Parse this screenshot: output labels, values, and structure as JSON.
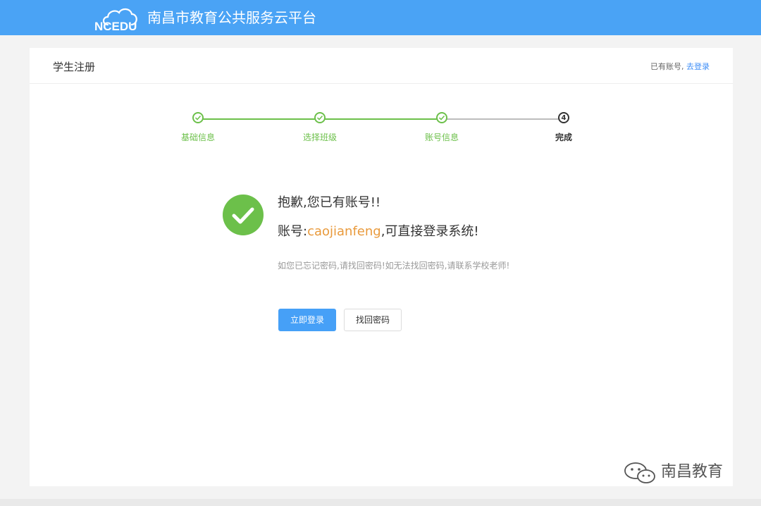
{
  "header": {
    "logo_text": "NCEDU",
    "site_title": "南昌市教育公共服务云平台",
    "brand_color": "#4aa3f5"
  },
  "card": {
    "title": "学生注册",
    "have_account_text": "已有账号,",
    "login_link": "去登录"
  },
  "steps": [
    {
      "label": "基础信息",
      "status": "done"
    },
    {
      "label": "选择班级",
      "status": "done"
    },
    {
      "label": "账号信息",
      "status": "done"
    },
    {
      "label": "完成",
      "status": "current",
      "number": "4"
    }
  ],
  "result": {
    "icon": "check-circle-icon",
    "line1": "抱歉,您已有账号!!",
    "line2_prefix": "账号:",
    "username": "caojianfeng",
    "line2_suffix": ",可直接登录系统!",
    "note": "如您已忘记密码,请找回密码!如无法找回密码,请联系学校老师!"
  },
  "buttons": {
    "login_now": "立即登录",
    "recover_password": "找回密码"
  },
  "watermark": {
    "text": "南昌教育",
    "icon": "wechat-icon"
  },
  "colors": {
    "success": "#6cc04a",
    "accent_link": "#3e8ef7",
    "username": "#e99a3c"
  }
}
